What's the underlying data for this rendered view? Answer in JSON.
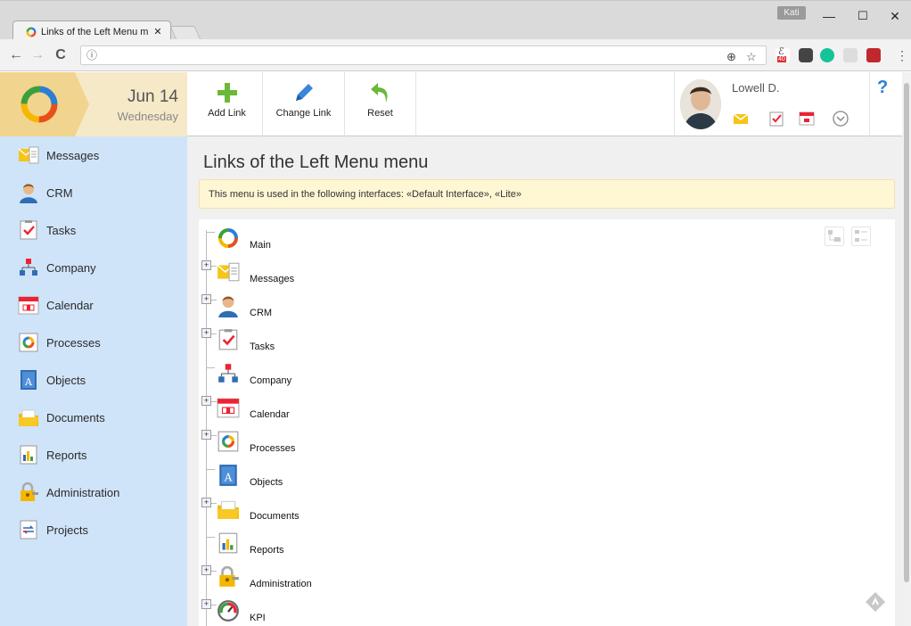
{
  "browser": {
    "tab_title": "Links of the Left Menu m",
    "tab_close": "✕",
    "user_chip": "Kati",
    "win_min": "—",
    "win_max": "☐",
    "win_close": "✕",
    "nav_back": "←",
    "nav_forward": "→",
    "nav_reload": "C",
    "site_info": "ⓘ",
    "zoom_icon": "⊕",
    "star_icon": "☆",
    "ext_badge": "40",
    "menu_icon": "⋮"
  },
  "header": {
    "date": "Jun 14",
    "weekday": "Wednesday",
    "tools": [
      {
        "label": "Add Link",
        "icon": "plus-icon",
        "color": "#6bb83a"
      },
      {
        "label": "Change Link",
        "icon": "pencil-icon",
        "color": "#3a86d8"
      },
      {
        "label": "Reset",
        "icon": "undo-icon",
        "color": "#6bb83a"
      }
    ],
    "user_name": "Lowell D.",
    "help": "?"
  },
  "sidebar": {
    "items": [
      {
        "label": "Messages",
        "icon": "messages-icon"
      },
      {
        "label": "CRM",
        "icon": "crm-icon"
      },
      {
        "label": "Tasks",
        "icon": "tasks-icon"
      },
      {
        "label": "Company",
        "icon": "company-icon"
      },
      {
        "label": "Calendar",
        "icon": "calendar-icon"
      },
      {
        "label": "Processes",
        "icon": "processes-icon"
      },
      {
        "label": "Objects",
        "icon": "objects-icon"
      },
      {
        "label": "Documents",
        "icon": "documents-icon"
      },
      {
        "label": "Reports",
        "icon": "reports-icon"
      },
      {
        "label": "Administration",
        "icon": "administration-icon"
      },
      {
        "label": "Projects",
        "icon": "projects-icon"
      }
    ],
    "collapse": "‹"
  },
  "main": {
    "title": "Links of the Left Menu menu",
    "notice": "This menu is used in the following interfaces: «Default Interface», «Lite»",
    "tree": [
      {
        "label": "Main",
        "icon": "main-logo-icon",
        "expandable": false
      },
      {
        "label": "Messages",
        "icon": "messages-icon",
        "expandable": true
      },
      {
        "label": "CRM",
        "icon": "crm-icon",
        "expandable": true
      },
      {
        "label": "Tasks",
        "icon": "tasks-icon",
        "expandable": true
      },
      {
        "label": "Company",
        "icon": "company-icon",
        "expandable": false
      },
      {
        "label": "Calendar",
        "icon": "calendar-icon",
        "expandable": true
      },
      {
        "label": "Processes",
        "icon": "processes-icon",
        "expandable": true
      },
      {
        "label": "Objects",
        "icon": "objects-icon",
        "expandable": false
      },
      {
        "label": "Documents",
        "icon": "documents-icon",
        "expandable": true
      },
      {
        "label": "Reports",
        "icon": "reports-icon",
        "expandable": false
      },
      {
        "label": "Administration",
        "icon": "administration-icon",
        "expandable": true
      },
      {
        "label": "KPI",
        "icon": "kpi-icon",
        "expandable": true
      }
    ],
    "tree_plus": "+"
  },
  "colors": {
    "sidebar_bg": "#cfe4f9",
    "notice_bg": "#fff6d4",
    "date_bg": "#f6e9c8",
    "accent_blue": "#2a7fd4"
  }
}
